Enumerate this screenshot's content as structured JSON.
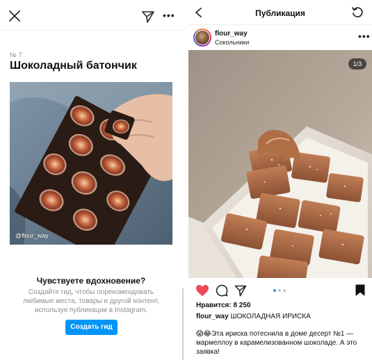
{
  "left_panel": {
    "guide_number": "№ 7",
    "guide_title": "Шоколадный батончик",
    "photo_credit": "@flour_way",
    "inspire": {
      "title": "Чувствуете вдохновение?",
      "text": "Создайте гид, чтобы порекомендовать любимые места, товары и другой контент, используя публикации в Instagram.",
      "button_label": "Создать гид"
    },
    "icons": [
      "close-icon",
      "send-icon",
      "more-icon"
    ]
  },
  "right_panel": {
    "title": "Публикация",
    "post": {
      "username": "flour_way",
      "location": "Сокольники",
      "image_counter": "1/3",
      "likes": "Нравится: 8 250",
      "caption_user": "flour_way",
      "caption_title": "ШОКОЛАДНАЯ ИРИСКА",
      "caption_text": "😱😂Эта ириска потеснила в доме десерт №1 — мармеллоу в карамелизованном шоколаде. А это заявка!",
      "carousel": {
        "total": 3,
        "active": 1
      }
    },
    "icons": [
      "back-icon",
      "refresh-icon",
      "more-icon",
      "heart-icon",
      "comment-icon",
      "share-icon",
      "bookmark-icon"
    ],
    "colors": {
      "heart": "#ed4956",
      "link_blue": "#0095f6",
      "dot_active": "#3897f0"
    }
  }
}
